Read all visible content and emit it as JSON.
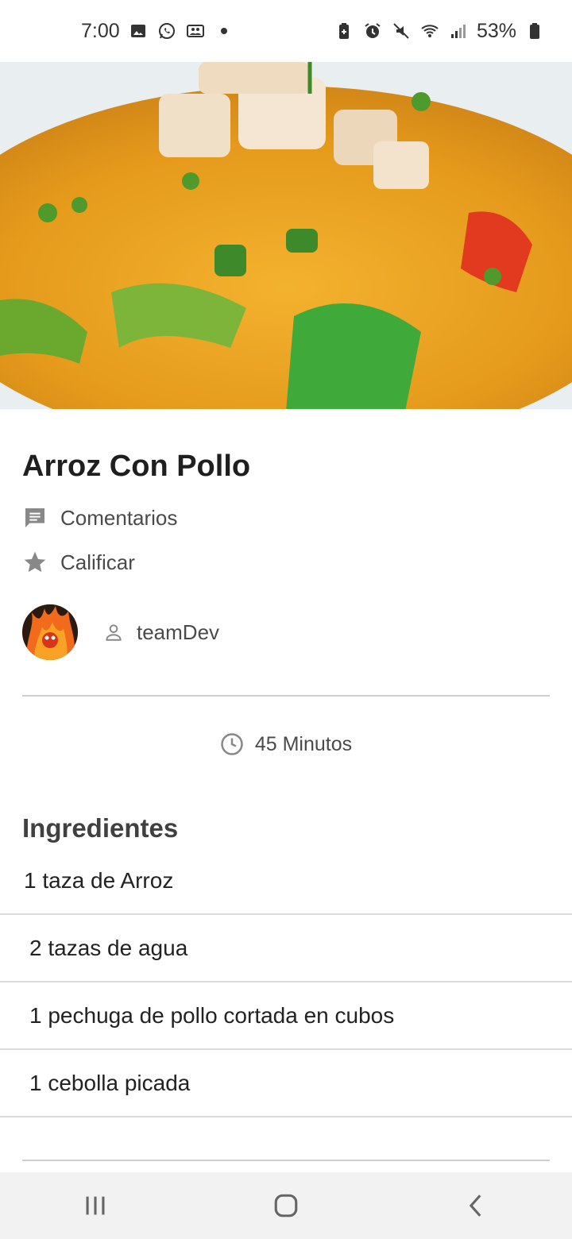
{
  "status_bar": {
    "time": "7:00",
    "battery": "53%",
    "left_icons": [
      "gallery-icon",
      "whatsapp-icon",
      "teams-icon",
      "dot-icon"
    ],
    "right_icons": [
      "battery-saver-icon",
      "alarm-icon",
      "mute-icon",
      "wifi-icon",
      "signal-icon",
      "battery-icon"
    ]
  },
  "recipe": {
    "title": "Arroz Con Pollo",
    "comments_label": "Comentarios",
    "rate_label": "Calificar",
    "author": "teamDev",
    "time": "45 Minutos"
  },
  "ingredients": {
    "section_title": "Ingredientes",
    "items": [
      "1 taza de Arroz",
      "2 tazas de agua",
      "1 pechuga de pollo cortada en cubos",
      "1 cebolla picada"
    ]
  },
  "nav_bar": {
    "buttons": [
      "recent-apps-icon",
      "home-icon",
      "back-icon"
    ]
  },
  "colors": {
    "text_primary": "#1f1f1f",
    "text_secondary": "#4a4a4a",
    "icon_gray": "#888888",
    "divider": "#cfcfcf",
    "nav_background": "#f2f2f2"
  }
}
